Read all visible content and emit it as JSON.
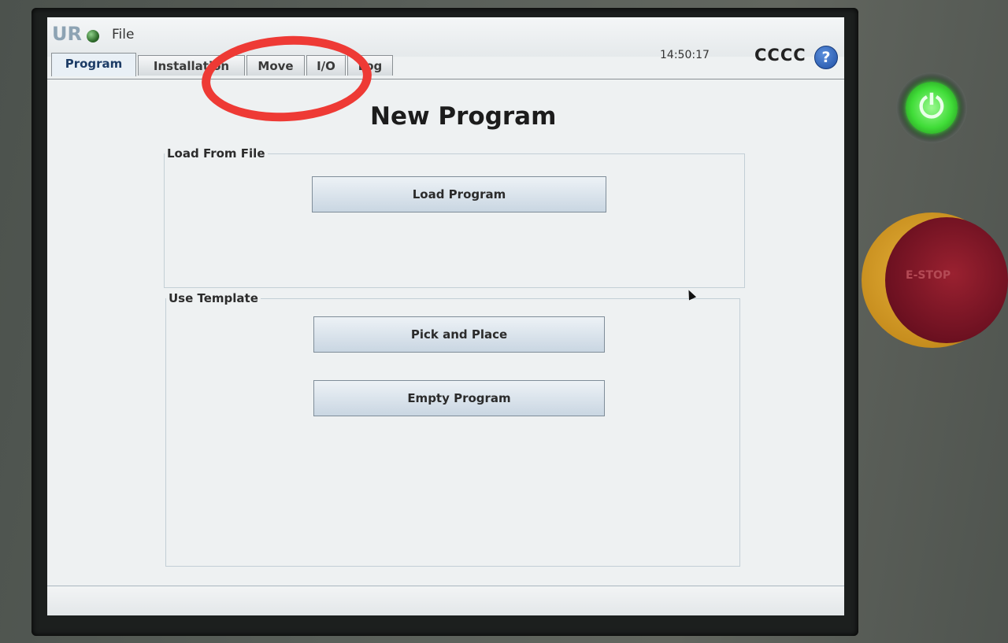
{
  "titlebar": {
    "menu": "File",
    "clock": "14:50:17",
    "robot_name": "CCCC",
    "help_symbol": "?"
  },
  "tabs": [
    {
      "label": "Program",
      "active": true
    },
    {
      "label": "Installation",
      "active": false
    },
    {
      "label": "Move",
      "active": false
    },
    {
      "label": "I/O",
      "active": false
    },
    {
      "label": "Log",
      "active": false
    }
  ],
  "main": {
    "title": "New Program",
    "load_group": {
      "legend": "Load From File",
      "load_button": "Load Program"
    },
    "template_group": {
      "legend": "Use Template",
      "pick_button": "Pick and Place",
      "empty_button": "Empty Program"
    }
  },
  "hardware": {
    "power_symbol": "⏻",
    "estop_label": "E-STOP"
  },
  "colors": {
    "annotation": "#ee3a35",
    "power_led": "#3fdc37",
    "estop": "#6b1020"
  }
}
